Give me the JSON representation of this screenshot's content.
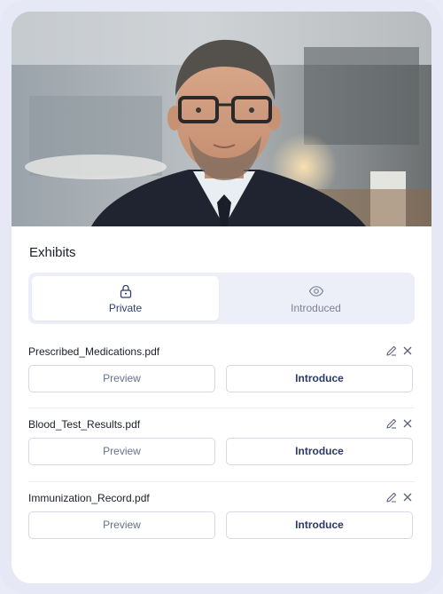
{
  "exhibits": {
    "title": "Exhibits",
    "tabs": [
      {
        "label": "Private",
        "icon": "lock-icon",
        "active": true
      },
      {
        "label": "Introduced",
        "icon": "eye-icon",
        "active": false
      }
    ],
    "files": [
      {
        "name": "Prescribed_Medications.pdf",
        "preview_label": "Preview",
        "introduce_label": "Introduce"
      },
      {
        "name": "Blood_Test_Results.pdf",
        "preview_label": "Preview",
        "introduce_label": "Introduce"
      },
      {
        "name": "Immunization_Record.pdf",
        "preview_label": "Preview",
        "introduce_label": "Introduce"
      }
    ]
  },
  "colors": {
    "accent": "#2d3f6e",
    "muted": "#7b8397",
    "tab_bg": "#eceff8",
    "frame": "#e6e9f5"
  }
}
